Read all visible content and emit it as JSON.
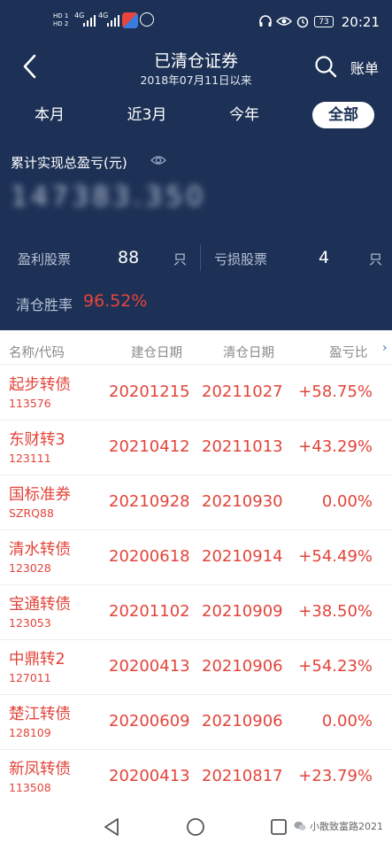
{
  "status_bar": {
    "sim1": "HD 1",
    "sim2": "HD 2",
    "net1": "4G",
    "net2": "4G",
    "battery": "73",
    "time": "20:21"
  },
  "header": {
    "title": "已清仓证券",
    "subtitle": "2018年07月11日以来",
    "ledger_label": "账单"
  },
  "tabs": [
    {
      "label": "本月",
      "active": false
    },
    {
      "label": "近3月",
      "active": false
    },
    {
      "label": "今年",
      "active": false
    },
    {
      "label": "全部",
      "active": true
    }
  ],
  "summary": {
    "total_label": "累计实现总盈亏(元)",
    "total_value": "147383.350",
    "profit_label": "盈利股票",
    "profit_count": "88",
    "profit_unit": "只",
    "loss_label": "亏损股票",
    "loss_count": "4",
    "loss_unit": "只",
    "win_rate_label": "清仓胜率",
    "win_rate_value": "96.52%"
  },
  "table": {
    "columns": [
      "名称/代码",
      "建仓日期",
      "清仓日期",
      "盈亏比"
    ],
    "more_indicator": "›",
    "rows": [
      {
        "name": "起步转债",
        "code": "113576",
        "open_date": "20201215",
        "close_date": "20211027",
        "pl_ratio": "+58.75%"
      },
      {
        "name": "东财转3",
        "code": "123111",
        "open_date": "20210412",
        "close_date": "20211013",
        "pl_ratio": "+43.29%"
      },
      {
        "name": "国标准券",
        "code": "SZRQ88",
        "open_date": "20210928",
        "close_date": "20210930",
        "pl_ratio": "0.00%"
      },
      {
        "name": "清水转债",
        "code": "123028",
        "open_date": "20200618",
        "close_date": "20210914",
        "pl_ratio": "+54.49%"
      },
      {
        "name": "宝通转债",
        "code": "123053",
        "open_date": "20201102",
        "close_date": "20210909",
        "pl_ratio": "+38.50%"
      },
      {
        "name": "中鼎转2",
        "code": "127011",
        "open_date": "20200413",
        "close_date": "20210906",
        "pl_ratio": "+54.23%"
      },
      {
        "name": "楚江转债",
        "code": "128109",
        "open_date": "20200609",
        "close_date": "20210906",
        "pl_ratio": "0.00%"
      },
      {
        "name": "新凤转债",
        "code": "113508",
        "open_date": "20200413",
        "close_date": "20210817",
        "pl_ratio": "+23.79%"
      }
    ]
  },
  "watermark": "小散致富路2021",
  "colors": {
    "header_bg": "#1d3156",
    "accent_red": "#e2443a",
    "muted_text": "#b8c3d6"
  },
  "icons": [
    "back-arrow-icon",
    "search-icon",
    "eye-icon",
    "nav-back-icon",
    "nav-home-icon",
    "nav-recent-icon"
  ]
}
